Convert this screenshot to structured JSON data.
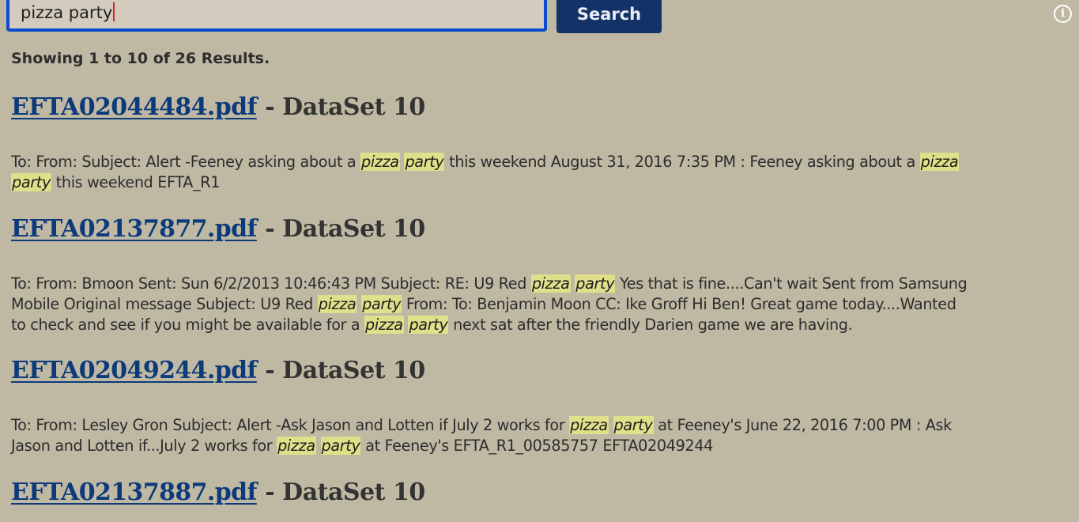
{
  "search": {
    "query": "pizza party",
    "button_label": "Search"
  },
  "info_icon": "info-icon",
  "result_count": "Showing 1 to 10 of 26 Results.",
  "results": [
    {
      "filename": "EFTA02044484.pdf",
      "dataset": "- DataSet 10",
      "lines": [
        [
          {
            "t": "To: From: Subject: Alert -Feeney asking about a "
          },
          {
            "t": "pizza",
            "h": true
          },
          {
            "t": " "
          },
          {
            "t": "party",
            "h": true
          },
          {
            "t": " this weekend August 31, 2016 7:35 PM : Feeney asking about a "
          },
          {
            "t": "pizza",
            "h": true
          }
        ],
        [
          {
            "t": "party",
            "h": true
          },
          {
            "t": " this weekend EFTA_R1"
          }
        ]
      ]
    },
    {
      "filename": "EFTA02137877.pdf",
      "dataset": "- DataSet 10",
      "lines": [
        [
          {
            "t": "To: From: Bmoon Sent: Sun 6/2/2013 10:46:43 PM Subject: RE: U9 Red "
          },
          {
            "t": "pizza",
            "h": true
          },
          {
            "t": " "
          },
          {
            "t": "party",
            "h": true
          },
          {
            "t": " Yes that is fine....Can't wait Sent from Samsung"
          }
        ],
        [
          {
            "t": "Mobile Original message Subject: U9 Red "
          },
          {
            "t": "pizza",
            "h": true
          },
          {
            "t": " "
          },
          {
            "t": "party",
            "h": true
          },
          {
            "t": " From: To: Benjamin Moon CC: Ike Groff Hi Ben! Great game today....Wanted"
          }
        ],
        [
          {
            "t": "to check and see if you might be available for a "
          },
          {
            "t": "pizza",
            "h": true
          },
          {
            "t": " "
          },
          {
            "t": "party",
            "h": true
          },
          {
            "t": " next sat after the friendly Darien game we are having."
          }
        ]
      ]
    },
    {
      "filename": "EFTA02049244.pdf",
      "dataset": "- DataSet 10",
      "lines": [
        [
          {
            "t": "To: From: Lesley Gron Subject: Alert -Ask Jason and Lotten if July 2 works for "
          },
          {
            "t": "pizza",
            "h": true
          },
          {
            "t": " "
          },
          {
            "t": "party",
            "h": true
          },
          {
            "t": " at Feeney's June 22, 2016 7:00 PM : Ask"
          }
        ],
        [
          {
            "t": "Jason and Lotten if...July 2 works for "
          },
          {
            "t": "pizza",
            "h": true
          },
          {
            "t": " "
          },
          {
            "t": "party",
            "h": true
          },
          {
            "t": " at Feeney's EFTA_R1_00585757 EFTA02049244"
          }
        ]
      ]
    },
    {
      "filename": "EFTA02137887.pdf",
      "dataset": "- DataSet 10",
      "lines": []
    }
  ]
}
